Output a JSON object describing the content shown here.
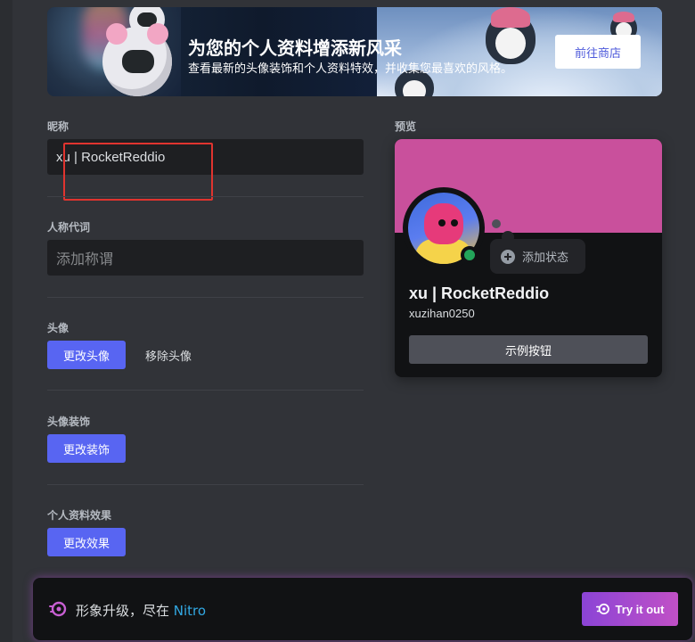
{
  "banner": {
    "title": "为您的个人资料增添新风采",
    "subtitle": "查看最新的头像装饰和个人资料特效，并收集您最喜欢的风格。",
    "shop_button": "前往商店"
  },
  "form": {
    "nickname": {
      "label": "昵称",
      "value": "xu | RocketReddio"
    },
    "pronouns": {
      "label": "人称代词",
      "placeholder": "添加称谓"
    },
    "avatar": {
      "label": "头像",
      "change_button": "更改头像",
      "remove_button": "移除头像"
    },
    "decoration": {
      "label": "头像装饰",
      "change_button": "更改装饰"
    },
    "effect": {
      "label": "个人资料效果",
      "change_button": "更改效果"
    }
  },
  "preview": {
    "label": "预览",
    "banner_color": "#c9509c",
    "status_color": "#23a55a",
    "add_status": "添加状态",
    "display_name": "xu | RocketReddio",
    "username": "xuzihan0250",
    "example_button": "示例按钮"
  },
  "nitro": {
    "text_prefix": "形象升级，尽在 ",
    "brand": "Nitro",
    "try_button": "Try it out",
    "accent": "#a849c7"
  }
}
